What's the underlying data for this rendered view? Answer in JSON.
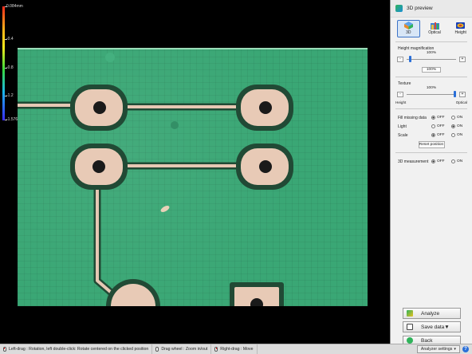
{
  "colorbar": {
    "labels": [
      "0.084mm",
      "-0.4",
      "-0.8",
      "-1.2",
      "-1.576"
    ]
  },
  "panel": {
    "title": "3D preview",
    "modes": [
      {
        "label": "3D",
        "icon": "3d-view-icon",
        "active": true
      },
      {
        "label": "Optical",
        "icon": "optical-view-icon",
        "active": false
      },
      {
        "label": "Height",
        "icon": "height-view-icon",
        "active": false
      }
    ],
    "height_magnification": {
      "label": "Height magnification",
      "value_top": "100%",
      "value_box": "100%",
      "level_fraction": 0.05
    },
    "texture": {
      "label": "Texture",
      "value_top": "100%",
      "left_end": "Height",
      "right_end": "Optical",
      "level_fraction": 1.0
    },
    "options": [
      {
        "label": "Fill missing data",
        "off": "OFF",
        "on": "ON",
        "selected": "OFF"
      },
      {
        "label": "Light",
        "off": "OFF",
        "on": "ON",
        "selected": "ON"
      },
      {
        "label": "Scale",
        "off": "OFF",
        "on": "ON",
        "selected": "OFF"
      }
    ],
    "reset_label": "Reset position",
    "measurement": {
      "label": "3D measurement",
      "off": "OFF",
      "on": "ON",
      "selected": "OFF"
    },
    "buttons": {
      "analyze": "Analyze",
      "save": "Save data",
      "back": "Back"
    },
    "slider_minus": "-",
    "slider_plus": "+"
  },
  "statusbar": {
    "left_drag": "Left-drag : Rotation, left double-click: Rotate centered on the clicked position",
    "wheel": "Drag wheel : Zoom in/out",
    "right_drag": "Right-drag : Move",
    "analyzer": "Analyzer settings",
    "help": "?"
  },
  "colors": {
    "pcb_green": "#3aa775",
    "pad_copper": "#e8c8b5",
    "accent": "#2a6fd8"
  }
}
